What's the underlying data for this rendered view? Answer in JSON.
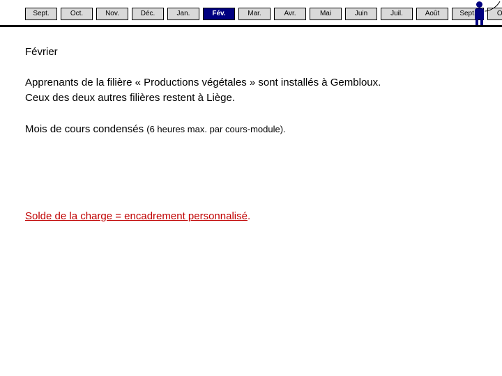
{
  "tabbar": {
    "tabs": [
      {
        "label": "Sept.",
        "active": false
      },
      {
        "label": "Oct.",
        "active": false
      },
      {
        "label": "Nov.",
        "active": false
      },
      {
        "label": "Déc.",
        "active": false
      },
      {
        "label": "Jan.",
        "active": false
      },
      {
        "label": "Fév.",
        "active": true
      },
      {
        "label": "Mar.",
        "active": false
      },
      {
        "label": "Avr.",
        "active": false
      },
      {
        "label": "Mai",
        "active": false
      },
      {
        "label": "Juin",
        "active": false
      },
      {
        "label": "Juil.",
        "active": false
      },
      {
        "label": "Août",
        "active": false
      },
      {
        "label": "Sept.",
        "active": false
      },
      {
        "label": "Oct.",
        "active": false
      }
    ],
    "active_label": "Fév.",
    "person_icon": "person-icon",
    "swoosh_icon": "swoosh-icon",
    "accent_color": "#000080",
    "tab_bg": "#d9d9d9"
  },
  "slide": {
    "heading": "Février",
    "paragraph1_line1": "Apprenants de la filière « Productions végétales » sont installés à Gembloux.",
    "paragraph1_line2": "Ceux des deux autres filières restent à Liège.",
    "paragraph2_main": "Mois de cours condensés ",
    "paragraph2_small": "(6 heures max. par cours-module).",
    "solde_underlined": "Solde de la charge = encadrement personnalisé",
    "solde_tail": ".",
    "solde_color": "#c00000"
  }
}
